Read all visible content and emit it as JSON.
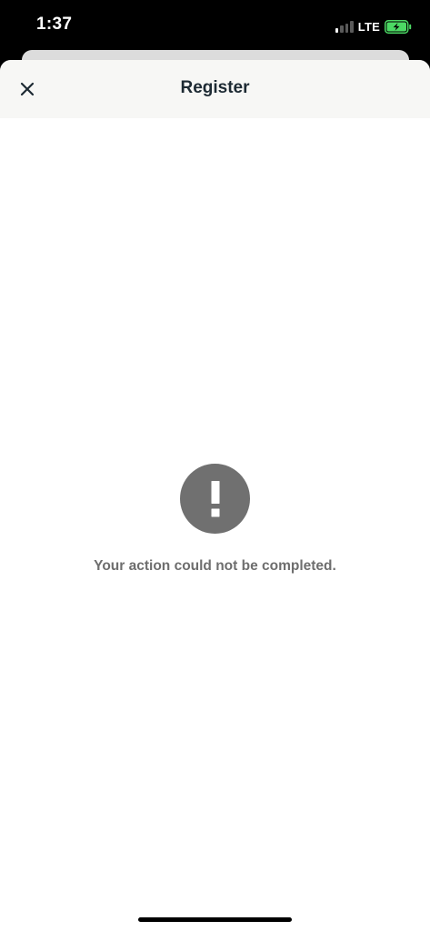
{
  "status_bar": {
    "time": "1:37",
    "network": "LTE",
    "signal_bars_active": 1,
    "signal_bars_total": 4,
    "battery_charging": true,
    "battery_color": "#4cd964"
  },
  "header": {
    "title": "Register",
    "close_icon": "close-icon"
  },
  "error": {
    "icon": "exclamation-icon",
    "icon_bg_color": "#707070",
    "message": "Your action could not be completed."
  }
}
